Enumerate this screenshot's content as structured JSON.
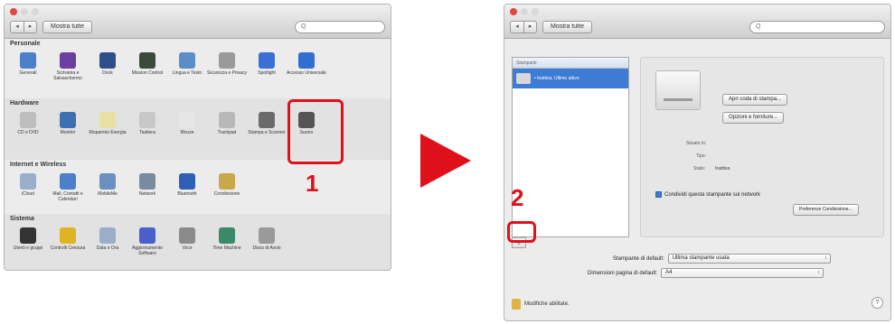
{
  "left_window": {
    "nav_back": "◂",
    "nav_forward": "▸",
    "show_all_label": "Mostra tutte",
    "search_placeholder": "Q",
    "sections": [
      {
        "title": "Personale",
        "items": [
          {
            "label": "Generali",
            "icon": "general-icon",
            "color": "#4a7fc9"
          },
          {
            "label": "Scrivania e Salvaschermo",
            "icon": "desktop-icon",
            "color": "#6a3fa0"
          },
          {
            "label": "Dock",
            "icon": "dock-icon",
            "color": "#2f4f8a"
          },
          {
            "label": "Mission Control",
            "icon": "mission-control-icon",
            "color": "#3c4a3c"
          },
          {
            "label": "Lingua e Testo",
            "icon": "language-icon",
            "color": "#5b8dc7"
          },
          {
            "label": "Sicurezza e Privacy",
            "icon": "security-icon",
            "color": "#9a9a9a"
          },
          {
            "label": "Spotlight",
            "icon": "spotlight-icon",
            "color": "#3a6fd6"
          },
          {
            "label": "Accesso Universale",
            "icon": "accessibility-icon",
            "color": "#2f6fd1"
          }
        ]
      },
      {
        "title": "Hardware",
        "items": [
          {
            "label": "CD e DVD",
            "icon": "cd-icon",
            "color": "#bdbdbd"
          },
          {
            "label": "Monitor",
            "icon": "monitor-icon",
            "color": "#3d6fb3"
          },
          {
            "label": "Risparmio Energia",
            "icon": "energy-icon",
            "color": "#e8e0a0"
          },
          {
            "label": "Tastiera",
            "icon": "keyboard-icon",
            "color": "#c8c8c8"
          },
          {
            "label": "Mouse",
            "icon": "mouse-icon",
            "color": "#e6e6e6"
          },
          {
            "label": "Trackpad",
            "icon": "trackpad-icon",
            "color": "#b8b8b8"
          },
          {
            "label": "Stampa e Scanner",
            "icon": "printer-icon",
            "color": "#6a6a6a"
          },
          {
            "label": "Suono",
            "icon": "sound-icon",
            "color": "#555555"
          }
        ]
      },
      {
        "title": "Internet e Wireless",
        "items": [
          {
            "label": "iCloud",
            "icon": "icloud-icon",
            "color": "#9aaecb"
          },
          {
            "label": "Mail, Contatti e Calendari",
            "icon": "mail-icon",
            "color": "#4a7fc9"
          },
          {
            "label": "MobileMe",
            "icon": "mobileme-icon",
            "color": "#6b90c0"
          },
          {
            "label": "Network",
            "icon": "network-icon",
            "color": "#7a8aa0"
          },
          {
            "label": "Bluetooth",
            "icon": "bluetooth-icon",
            "color": "#2f5fb5"
          },
          {
            "label": "Condivisione",
            "icon": "sharing-icon",
            "color": "#c8a84a"
          }
        ]
      },
      {
        "title": "Sistema",
        "items": [
          {
            "label": "Utenti e gruppi",
            "icon": "users-icon",
            "color": "#333333"
          },
          {
            "label": "Controlli Censura",
            "icon": "parental-icon",
            "color": "#e0b320"
          },
          {
            "label": "Data e Ora",
            "icon": "date-time-icon",
            "color": "#9aaecb"
          },
          {
            "label": "Aggiornamento Software",
            "icon": "software-update-icon",
            "color": "#4a5fc9"
          },
          {
            "label": "Voce",
            "icon": "speech-icon",
            "color": "#8a8a8a"
          },
          {
            "label": "Time Machine",
            "icon": "time-machine-icon",
            "color": "#3a8a6a"
          },
          {
            "label": "Disco di Avvio",
            "icon": "startup-disk-icon",
            "color": "#9a9a9a"
          }
        ]
      }
    ]
  },
  "steps": {
    "one": "1",
    "two": "2"
  },
  "accent_color": "#e0101a",
  "right_window": {
    "nav_back": "◂",
    "nav_forward": "▸",
    "show_all_label": "Mostra tutte",
    "search_placeholder": "Q",
    "printers_header": "Stampanti",
    "printer_status": "• Inattiva, Ultimo attivo",
    "plus_label": "+",
    "open_queue_label": "Apri coda di stampa...",
    "options_label": "Opzioni e forniture...",
    "location_label": "Situato in:",
    "type_label": "Tipo:",
    "status_label": "Stato:",
    "status_value": "Inattiva",
    "share_label": "Condividi questa stampante sul network",
    "sharing_prefs_label": "Preferenze Condivisione...",
    "default_printer_label": "Stampante di default:",
    "default_printer_value": "Ultima stampante usata",
    "default_paper_label": "Dimensioni pagina di default:",
    "default_paper_value": "A4",
    "lock_label": "Modifiche abilitate.",
    "help_label": "?"
  }
}
